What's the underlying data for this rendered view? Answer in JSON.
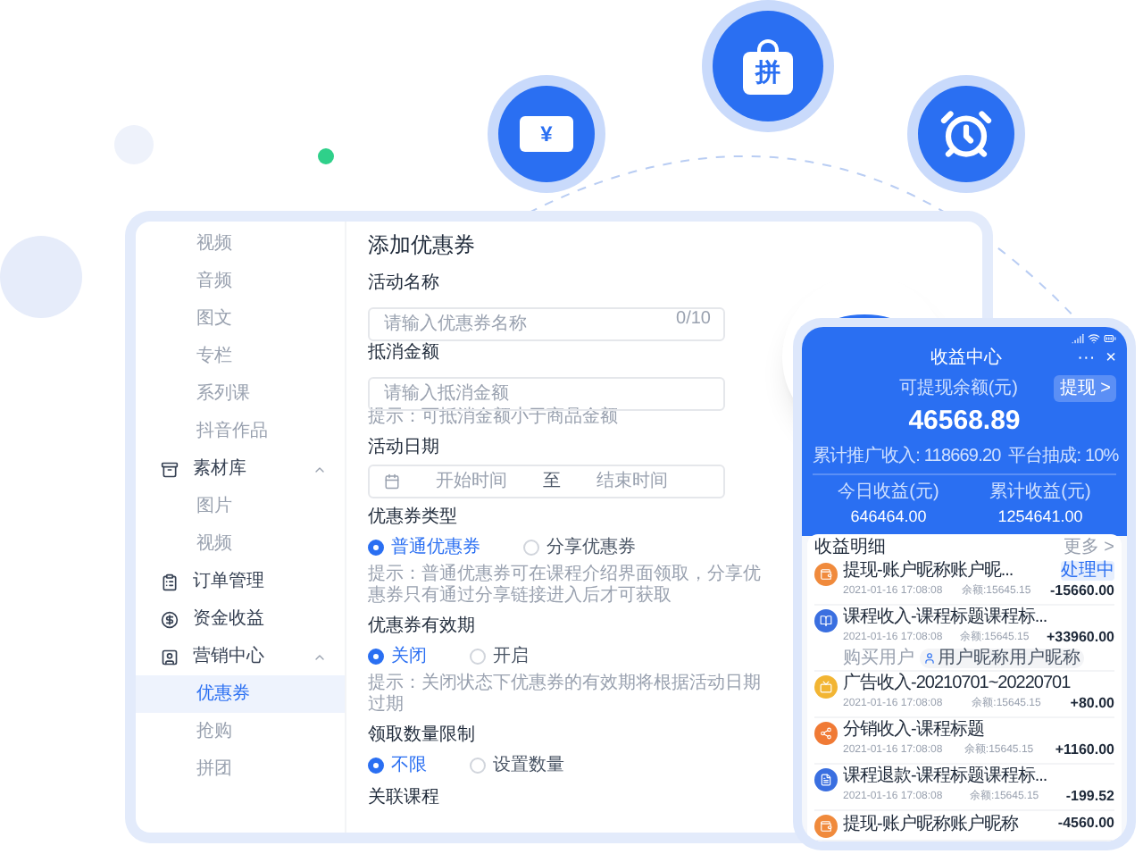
{
  "floating_icons": [
    {
      "kind": "ticket",
      "symbol": "¥"
    },
    {
      "kind": "bag",
      "symbol": "拼"
    },
    {
      "kind": "alarm"
    }
  ],
  "sidebar": {
    "items": [
      {
        "label": "视频",
        "kind": "sub",
        "selected": false
      },
      {
        "label": "音频",
        "kind": "sub",
        "selected": false
      },
      {
        "label": "图文",
        "kind": "sub",
        "selected": false
      },
      {
        "label": "专栏",
        "kind": "sub",
        "selected": false
      },
      {
        "label": "系列课",
        "kind": "sub",
        "selected": false
      },
      {
        "label": "抖音作品",
        "kind": "sub",
        "selected": false
      },
      {
        "label": "素材库",
        "kind": "group",
        "expanded": true,
        "children": [
          {
            "label": "图片",
            "selected": false
          },
          {
            "label": "视频",
            "selected": false
          }
        ]
      },
      {
        "label": "订单管理",
        "kind": "group"
      },
      {
        "label": "资金收益",
        "kind": "group"
      },
      {
        "label": "营销中心",
        "kind": "group",
        "expanded": true,
        "children": [
          {
            "label": "优惠券",
            "selected": true
          },
          {
            "label": "抢购",
            "selected": false
          },
          {
            "label": "拼团",
            "selected": false
          }
        ]
      }
    ]
  },
  "form": {
    "title": "添加优惠券",
    "fields": [
      {
        "kind": "text",
        "label": "活动名称",
        "placeholder": "请输入优惠券名称",
        "counter": "0/10"
      },
      {
        "kind": "text",
        "label": "抵消金额",
        "placeholder": "请输入抵消金额",
        "hint": "提示：可抵消金额小于商品金额"
      },
      {
        "kind": "date",
        "label": "活动日期",
        "start": "开始时间",
        "separator": "至",
        "end": "结束时间"
      },
      {
        "kind": "radio",
        "label": "优惠券类型",
        "options": [
          {
            "label": "普通优惠券",
            "selected": true
          },
          {
            "label": "分享优惠券",
            "selected": false
          }
        ],
        "hint": "提示：普通优惠券可在课程介绍界面领取，分享优惠券只有通过分享链接进入后才可获取"
      },
      {
        "kind": "radio",
        "label": "优惠券有效期",
        "options": [
          {
            "label": "关闭",
            "selected": true
          },
          {
            "label": "开启",
            "selected": false
          }
        ],
        "hint": "提示：关闭状态下优惠券的有效期将根据活动日期过期"
      },
      {
        "kind": "radio",
        "label": "领取数量限制",
        "options": [
          {
            "label": "不限",
            "selected": true
          },
          {
            "label": "设置数量",
            "selected": false
          }
        ]
      },
      {
        "kind": "heading",
        "label": "关联课程"
      }
    ]
  },
  "phone": {
    "title": "收益中心",
    "more": "···",
    "close": "×",
    "balance_label": "可提现余额(元)",
    "balance": "46568.89",
    "withdraw": "提现 >",
    "stats": [
      "累计推广收入: 118669.20",
      "平台抽成: 10%"
    ],
    "totals": [
      {
        "label": "今日收益(元)",
        "value": "646464.00"
      },
      {
        "label": "累计收益(元)",
        "value": "1254641.00"
      }
    ],
    "list_title": "收益明细",
    "more_link": "更多 >",
    "rows": [
      {
        "title": "提现-账户昵称账户昵...",
        "tag": "处理中",
        "amount": "-15660.00",
        "date": "2021-01-16 17:08:08",
        "balance": "余额:15645.15",
        "color": "#f08a3c"
      },
      {
        "title": "课程收入-课程标题课程标...",
        "amount": "+33960.00",
        "date": "2021-01-16 17:08:08",
        "balance": "余额:15645.15",
        "buyer_label": "购买用户",
        "buyer": "用户昵称用户昵称",
        "color": "#3a6fe0"
      },
      {
        "title": "广告收入-20210701~20220701",
        "amount": "+80.00",
        "date": "2021-01-16 17:08:08",
        "balance": "余额:15645.15",
        "color": "#f2b533"
      },
      {
        "title": "分销收入-课程标题",
        "amount": "+1160.00",
        "date": "2021-01-16 17:08:08",
        "balance": "余额:15645.15",
        "color": "#f07a35"
      },
      {
        "title": "课程退款-课程标题课程标...",
        "amount": "-199.52",
        "date": "2021-01-16 17:08:08",
        "balance": "余额:15645.15",
        "color": "#3a6fe0"
      },
      {
        "title": "提现-账户昵称账户昵称",
        "amount": "-4560.00",
        "color": "#f08a3c"
      }
    ]
  }
}
